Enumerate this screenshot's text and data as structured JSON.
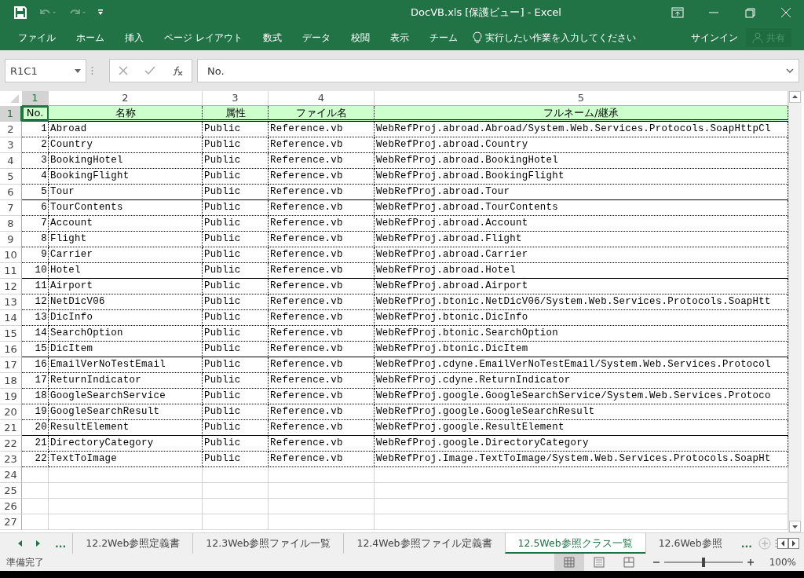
{
  "window": {
    "title": "DocVB.xls  [保護ビュー] - Excel"
  },
  "ribbon_tabs": [
    {
      "label": "ファイル"
    },
    {
      "label": "ホーム"
    },
    {
      "label": "挿入"
    },
    {
      "label": "ページ レイアウト"
    },
    {
      "label": "数式"
    },
    {
      "label": "データ"
    },
    {
      "label": "校閲"
    },
    {
      "label": "表示"
    },
    {
      "label": "チーム"
    }
  ],
  "tell_me": {
    "placeholder": "実行したい作業を入力してください"
  },
  "sign_in": "サインイン",
  "share_button": {
    "label": "共有",
    "disabled": true
  },
  "formula_bar": {
    "name_box": "R1C1",
    "formula": "No."
  },
  "column_headers": [
    "1",
    "2",
    "3",
    "4",
    "5"
  ],
  "row_numbers": [
    "1",
    "2",
    "3",
    "4",
    "5",
    "6",
    "7",
    "8",
    "9",
    "10",
    "11",
    "12",
    "13",
    "14",
    "15",
    "16",
    "17",
    "18",
    "19",
    "20",
    "21",
    "22",
    "23",
    "24",
    "25",
    "26",
    "27"
  ],
  "table": {
    "columns": [
      "No.",
      "名称",
      "属性",
      "ファイル名",
      "フルネーム/継承"
    ],
    "rows": [
      [
        "1",
        "Abroad",
        "Public",
        "Reference.vb",
        "WebRefProj.abroad.Abroad/System.Web.Services.Protocols.SoapHttpCl"
      ],
      [
        "2",
        "Country",
        "Public",
        "Reference.vb",
        "WebRefProj.abroad.Country"
      ],
      [
        "3",
        "BookingHotel",
        "Public",
        "Reference.vb",
        "WebRefProj.abroad.BookingHotel"
      ],
      [
        "4",
        "BookingFlight",
        "Public",
        "Reference.vb",
        "WebRefProj.abroad.BookingFlight"
      ],
      [
        "5",
        "Tour",
        "Public",
        "Reference.vb",
        "WebRefProj.abroad.Tour"
      ],
      [
        "6",
        "TourContents",
        "Public",
        "Reference.vb",
        "WebRefProj.abroad.TourContents"
      ],
      [
        "7",
        "Account",
        "Public",
        "Reference.vb",
        "WebRefProj.abroad.Account"
      ],
      [
        "8",
        "Flight",
        "Public",
        "Reference.vb",
        "WebRefProj.abroad.Flight"
      ],
      [
        "9",
        "Carrier",
        "Public",
        "Reference.vb",
        "WebRefProj.abroad.Carrier"
      ],
      [
        "10",
        "Hotel",
        "Public",
        "Reference.vb",
        "WebRefProj.abroad.Hotel"
      ],
      [
        "11",
        "Airport",
        "Public",
        "Reference.vb",
        "WebRefProj.abroad.Airport"
      ],
      [
        "12",
        "NetDicV06",
        "Public",
        "Reference.vb",
        "WebRefProj.btonic.NetDicV06/System.Web.Services.Protocols.SoapHtt"
      ],
      [
        "13",
        "DicInfo",
        "Public",
        "Reference.vb",
        "WebRefProj.btonic.DicInfo"
      ],
      [
        "14",
        "SearchOption",
        "Public",
        "Reference.vb",
        "WebRefProj.btonic.SearchOption"
      ],
      [
        "15",
        "DicItem",
        "Public",
        "Reference.vb",
        "WebRefProj.btonic.DicItem"
      ],
      [
        "16",
        "EmailVerNoTestEmail",
        "Public",
        "Reference.vb",
        "WebRefProj.cdyne.EmailVerNoTestEmail/System.Web.Services.Protocol"
      ],
      [
        "17",
        "ReturnIndicator",
        "Public",
        "Reference.vb",
        "WebRefProj.cdyne.ReturnIndicator"
      ],
      [
        "18",
        "GoogleSearchService",
        "Public",
        "Reference.vb",
        "WebRefProj.google.GoogleSearchService/System.Web.Services.Protoco"
      ],
      [
        "19",
        "GoogleSearchResult",
        "Public",
        "Reference.vb",
        "WebRefProj.google.GoogleSearchResult"
      ],
      [
        "20",
        "ResultElement",
        "Public",
        "Reference.vb",
        "WebRefProj.google.ResultElement"
      ],
      [
        "21",
        "DirectoryCategory",
        "Public",
        "Reference.vb",
        "WebRefProj.google.DirectoryCategory"
      ],
      [
        "22",
        "TextToImage",
        "Public",
        "Reference.vb",
        "WebRefProj.Image.TextToImage/System.Web.Services.Protocols.SoapHt"
      ]
    ]
  },
  "sheet_more": "...",
  "sheet_tabs": [
    {
      "label": "12.2Web参照定義書",
      "selected": false
    },
    {
      "label": "12.3Web参照ファイル一覧",
      "selected": false
    },
    {
      "label": "12.4Web参照ファイル定義書",
      "selected": false
    },
    {
      "label": "12.5Web参照クラス一覧",
      "selected": true
    },
    {
      "label": "12.6Web参照",
      "selected": false
    }
  ],
  "sheet_tabs_more": "...",
  "status_bar": {
    "text": "準備完了",
    "zoom": "100%",
    "zoom_slider": {
      "level": 0.5
    }
  }
}
